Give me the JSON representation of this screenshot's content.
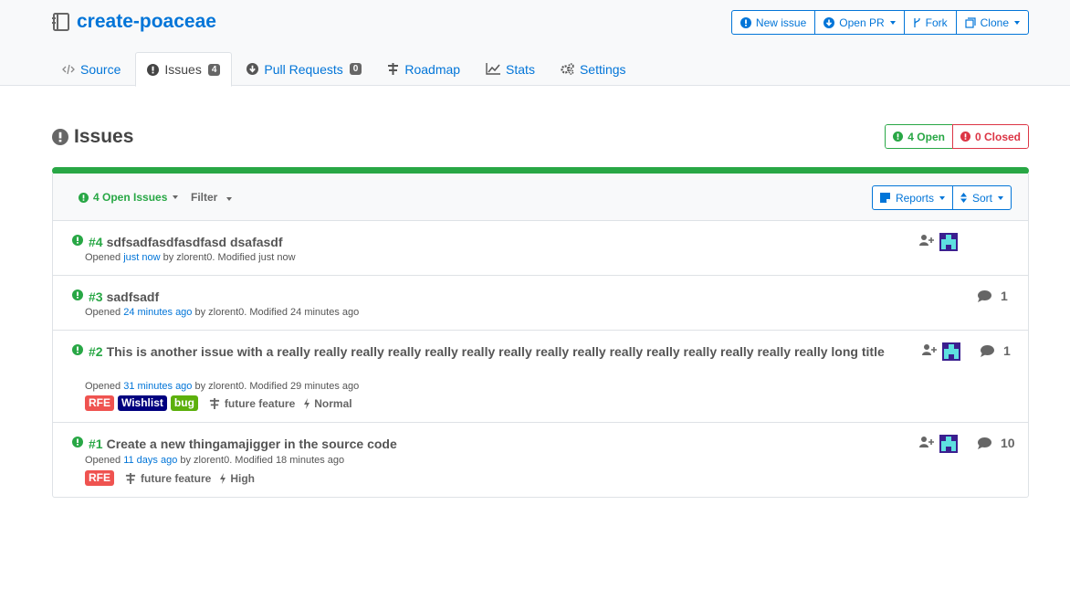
{
  "repo": {
    "name": "create-poaceae"
  },
  "actions": {
    "new_issue": "New issue",
    "open_pr": "Open PR",
    "fork": "Fork",
    "clone": "Clone"
  },
  "tabs": [
    {
      "label": "Source"
    },
    {
      "label": "Issues",
      "badge": "4"
    },
    {
      "label": "Pull Requests",
      "badge": "0"
    },
    {
      "label": "Roadmap"
    },
    {
      "label": "Stats"
    },
    {
      "label": "Settings"
    }
  ],
  "page_title": "Issues",
  "status": {
    "open": "4 Open",
    "closed": "0 Closed"
  },
  "progress": {
    "open_fraction": 1.0
  },
  "toolbar": {
    "open_issues": "4 Open Issues",
    "filter": "Filter",
    "reports": "Reports",
    "sort": "Sort"
  },
  "issues": [
    {
      "number": "#4",
      "title": "sdfsadfasdfasdfasd dsafasdf",
      "meta_prefix": "Opened ",
      "opened": "just now",
      "meta_suffix": " by zlorent0. Modified just now",
      "comments": ""
    },
    {
      "number": "#3",
      "title": "sadfsadf",
      "meta_prefix": "Opened ",
      "opened": "24 minutes ago",
      "meta_suffix": " by zlorent0. Modified 24 minutes ago",
      "comments": "1"
    },
    {
      "number": "#2",
      "title": "This is another issue with a really really really really really really really really really really really really really really really long title",
      "meta_prefix": "Opened ",
      "opened": "31 minutes ago",
      "meta_suffix": " by zlorent0. Modified 29 minutes ago",
      "tags": [
        "RFE",
        "Wishlist",
        "bug"
      ],
      "milestone": "future feature",
      "priority": "Normal",
      "comments": "1"
    },
    {
      "number": "#1",
      "title": "Create a new thingamajigger in the source code",
      "meta_prefix": "Opened ",
      "opened": "11 days ago",
      "meta_suffix": " by zlorent0. Modified 18 minutes ago",
      "tags": [
        "RFE"
      ],
      "milestone": "future feature",
      "priority": "High",
      "comments": "10"
    }
  ],
  "colors": {
    "accent": "#0275d8",
    "open": "#28a745",
    "closed": "#dc3545",
    "rfe": "#ef5350",
    "wishlist": "#00007f",
    "bug": "#5cb00c"
  },
  "icons": [
    "repo-icon",
    "code-icon",
    "exclamation-circle-icon",
    "arrow-circle-down-icon",
    "roadmap-icon",
    "chart-icon",
    "gears-icon",
    "comment-icon",
    "user-plus-icon",
    "sort-icon",
    "report-icon",
    "bolt-icon"
  ]
}
